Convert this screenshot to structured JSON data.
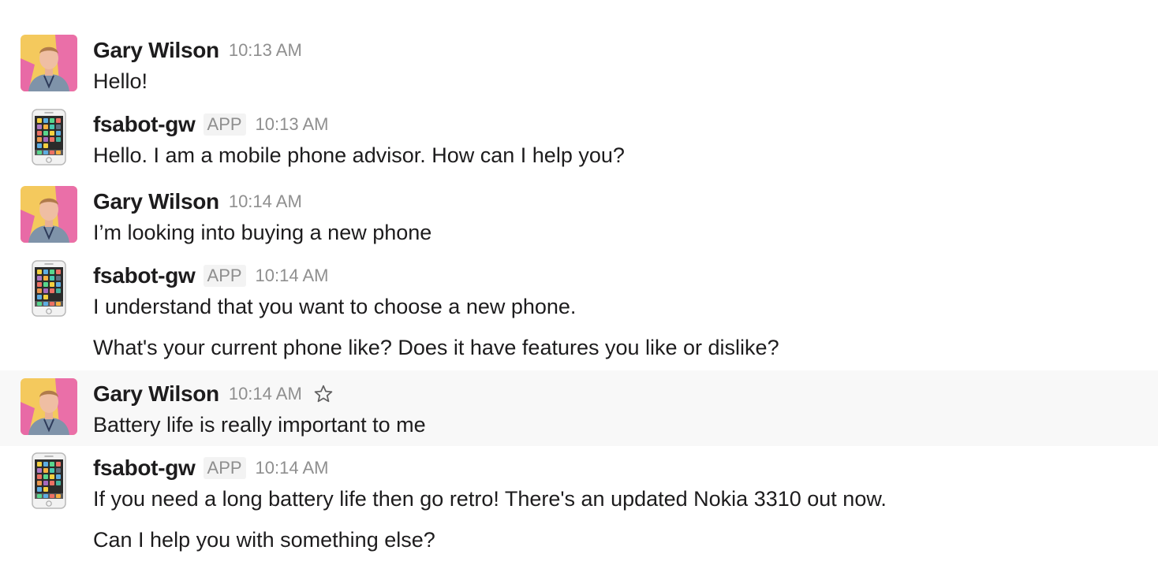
{
  "users": {
    "gary": {
      "name": "Gary Wilson",
      "avatar_icon": "person-photo-icon"
    },
    "bot": {
      "name": "fsabot-gw",
      "badge": "APP",
      "avatar_icon": "mobile-phone-icon"
    }
  },
  "messages": [
    {
      "sender": "gary",
      "time": "10:13 AM",
      "lines": [
        "Hello!"
      ]
    },
    {
      "sender": "bot",
      "time": "10:13 AM",
      "lines": [
        "Hello. I am a mobile phone advisor. How can I help you?"
      ]
    },
    {
      "sender": "gary",
      "time": "10:14 AM",
      "lines": [
        "I’m looking into buying a new phone"
      ]
    },
    {
      "sender": "bot",
      "time": "10:14 AM",
      "lines": [
        "I understand that you want to choose a new phone.",
        "What's your current phone like? Does it have features you like or dislike?"
      ]
    },
    {
      "sender": "gary",
      "time": "10:14 AM",
      "lines": [
        "Battery life is really important to me"
      ],
      "hovered": true,
      "action_icon": "star-icon"
    },
    {
      "sender": "bot",
      "time": "10:14 AM",
      "lines": [
        "If you need a long battery life then go retro! There's an updated Nokia 3310 out now.",
        "Can I help you with something else?"
      ]
    }
  ],
  "colors": {
    "text": "#1d1c1d",
    "timestamp": "#8f8f8f",
    "hover_background": "#f8f8f8",
    "badge_background": "#f3f3f3"
  }
}
